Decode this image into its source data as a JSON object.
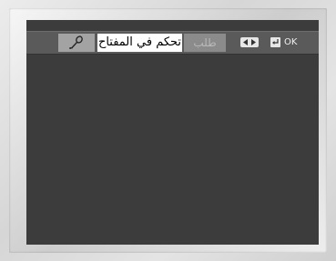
{
  "menu": {
    "key_control_label": "تحكم في المفتاح",
    "request_label": "طلب"
  },
  "hints": {
    "ok_label": "OK"
  },
  "icons": {
    "mic": "microphone-icon",
    "left_right": "left-right-arrows-icon",
    "enter": "enter-icon"
  },
  "colors": {
    "screen_bg": "#3c3c3c",
    "menu_bar": "#5a5a5a",
    "highlight": "#ffffff",
    "disabled_item": "#8b8b8b"
  }
}
